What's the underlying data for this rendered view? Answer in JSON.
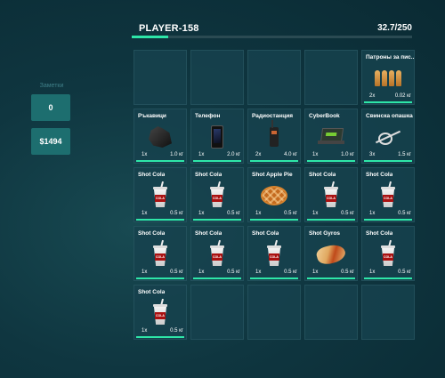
{
  "side": {
    "label": "Заметки",
    "btn1": "0",
    "btn2": "$1494"
  },
  "header": {
    "player": "PLAYER-158",
    "weight": "32.7/250",
    "fill_fraction": 0.13
  },
  "colors": {
    "accent": "#2ee6a8",
    "button": "#1d6e6f"
  },
  "slots": [
    {
      "empty": true
    },
    {
      "empty": true
    },
    {
      "empty": true
    },
    {
      "empty": true
    },
    {
      "name": "Патроны за пис...",
      "qty": "2x",
      "weight": "0.02 кг",
      "icon": "bullets-icon"
    },
    {
      "name": "Ръкавици",
      "qty": "1x",
      "weight": "1.0 кг",
      "icon": "gloves-icon"
    },
    {
      "name": "Телефон",
      "qty": "1x",
      "weight": "2.0 кг",
      "icon": "phone-icon"
    },
    {
      "name": "Радиостанция",
      "qty": "2x",
      "weight": "4.0 кг",
      "icon": "radio-icon"
    },
    {
      "name": "CyberBook",
      "qty": "1x",
      "weight": "1.0 кг",
      "icon": "laptop-icon"
    },
    {
      "name": "Свинска опашка",
      "qty": "3x",
      "weight": "1.5 кг",
      "icon": "zip-tie-icon"
    },
    {
      "name": "Shot Cola",
      "qty": "1x",
      "weight": "0.5 кг",
      "icon": "cola-icon"
    },
    {
      "name": "Shot Cola",
      "qty": "1x",
      "weight": "0.5 кг",
      "icon": "cola-icon"
    },
    {
      "name": "Shot Apple Pie",
      "qty": "1x",
      "weight": "0.5 кг",
      "icon": "pie-icon"
    },
    {
      "name": "Shot Cola",
      "qty": "1x",
      "weight": "0.5 кг",
      "icon": "cola-icon"
    },
    {
      "name": "Shot Cola",
      "qty": "1x",
      "weight": "0.5 кг",
      "icon": "cola-icon"
    },
    {
      "name": "Shot Cola",
      "qty": "1x",
      "weight": "0.5 кг",
      "icon": "cola-icon"
    },
    {
      "name": "Shot Cola",
      "qty": "1x",
      "weight": "0.5 кг",
      "icon": "cola-icon"
    },
    {
      "name": "Shot Cola",
      "qty": "1x",
      "weight": "0.5 кг",
      "icon": "cola-icon"
    },
    {
      "name": "Shot Gyros",
      "qty": "1x",
      "weight": "0.5 кг",
      "icon": "gyros-icon"
    },
    {
      "name": "Shot Cola",
      "qty": "1x",
      "weight": "0.5 кг",
      "icon": "cola-icon"
    },
    {
      "name": "Shot Cola",
      "qty": "1x",
      "weight": "0.5 кг",
      "icon": "cola-icon"
    },
    {
      "empty": true
    },
    {
      "empty": true
    },
    {
      "empty": true
    },
    {
      "empty": true
    }
  ]
}
